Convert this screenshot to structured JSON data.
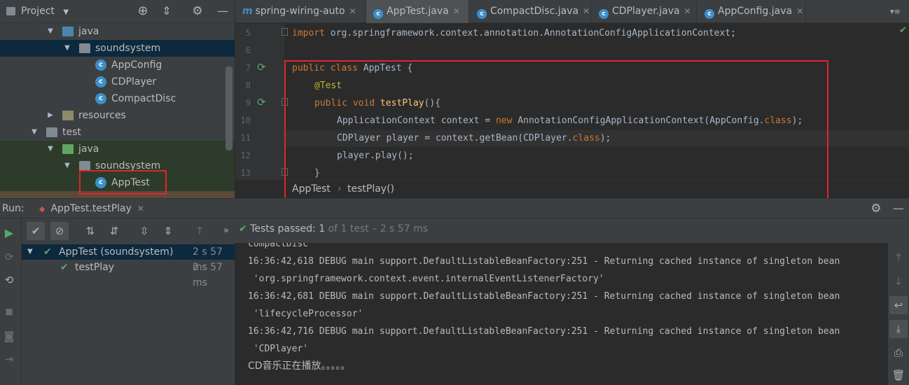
{
  "project": {
    "header_label": "Project",
    "items": [
      {
        "label": "java",
        "kind": "folder-blue"
      },
      {
        "label": "soundsystem",
        "kind": "package"
      },
      {
        "label": "AppConfig",
        "kind": "class"
      },
      {
        "label": "CDPlayer",
        "kind": "class"
      },
      {
        "label": "CompactDisc",
        "kind": "class"
      },
      {
        "label": "resources",
        "kind": "folder-res"
      },
      {
        "label": "test",
        "kind": "folder"
      },
      {
        "label": "java",
        "kind": "folder-green"
      },
      {
        "label": "soundsystem",
        "kind": "package"
      },
      {
        "label": "AppTest",
        "kind": "class-test"
      }
    ]
  },
  "tabs": [
    {
      "label": "spring-wiring-auto",
      "icon": "m-module-icon"
    },
    {
      "label": "AppTest.java",
      "icon": "class-icon",
      "active": true
    },
    {
      "label": "CompactDisc.java",
      "icon": "class-icon"
    },
    {
      "label": "CDPlayer.java",
      "icon": "class-icon"
    },
    {
      "label": "AppConfig.java",
      "icon": "class-icon"
    }
  ],
  "editor": {
    "line_numbers": [
      "5",
      "6",
      "7",
      "8",
      "9",
      "10",
      "11",
      "12",
      "13"
    ],
    "lines": {
      "l5_kw": "import",
      "l5_rest": " org.springframework.context.annotation.AnnotationConfigApplicationContext;",
      "l7_kw": "public class",
      "l7_rest": " AppTest {",
      "l8": "@Test",
      "l9_kw": "public void",
      "l9_fn": "testPlay",
      "l9_rest": "(){",
      "l10_a": "ApplicationContext context = ",
      "l10_new": "new",
      "l10_b": " AnnotationConfigApplicationContext(AppConfig.",
      "l10_cls": "class",
      "l10_c": ");",
      "l11_a": "CDPlayer player = context.getBean(CDPlayer.",
      "l11_cls": "class",
      "l11_c": ");",
      "l12": "player.play();",
      "l13": "}"
    }
  },
  "breadcrumb": {
    "class": "AppTest",
    "sep": "›",
    "method": "testPlay()"
  },
  "run": {
    "label": "Run:",
    "tab": "AppTest.testPlay",
    "status_prefix": "Tests passed:",
    "status_count": "1",
    "status_of": "of 1 test",
    "status_time": "– 2 s 57 ms"
  },
  "tests": [
    {
      "label": "AppTest (soundsystem)",
      "time": "2 s 57 ms"
    },
    {
      "label": "testPlay",
      "time": "2 s 57 ms"
    }
  ],
  "console": [
    "compactDisc",
    "16:36:42,618 DEBUG main support.DefaultListableBeanFactory:251 - Returning cached instance of singleton bean",
    " 'org.springframework.context.event.internalEventListenerFactory'",
    "16:36:42,681 DEBUG main support.DefaultListableBeanFactory:251 - Returning cached instance of singleton bean",
    " 'lifecycleProcessor'",
    "16:36:42,716 DEBUG main support.DefaultListableBeanFactory:251 - Returning cached instance of singleton bean",
    " 'CDPlayer'",
    "CD音乐正在播放。。。。。"
  ]
}
